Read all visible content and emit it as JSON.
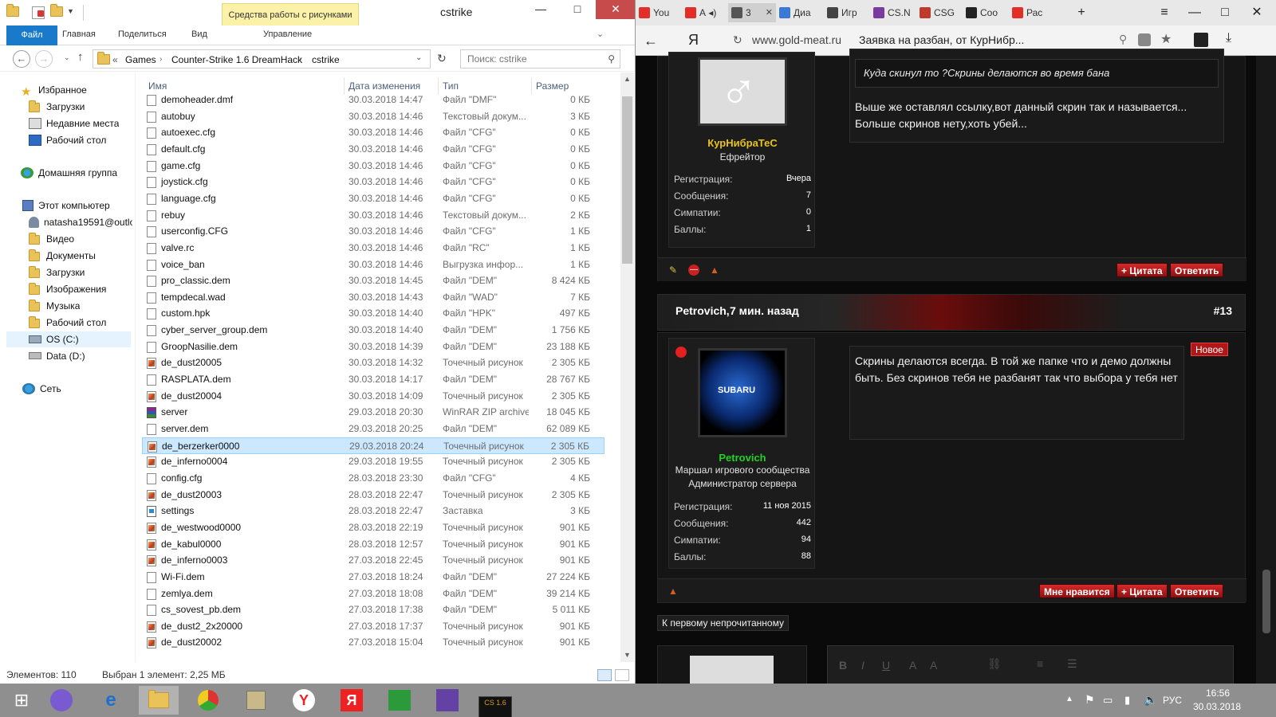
{
  "explorer": {
    "title": "cstrike",
    "context_tab": "Средства работы с рисунками",
    "ribbon_tabs": [
      "Файл",
      "Главная",
      "Поделиться",
      "Вид"
    ],
    "ribbon_context_label": "Управление",
    "breadcrumb": [
      "Games",
      "Counter-Strike 1.6 DreamHack",
      "cstrike"
    ],
    "breadcrumb_prefix": "«",
    "search_placeholder": "Поиск: cstrike",
    "nav": {
      "favorites": "Избранное",
      "fav_items": [
        "Загрузки",
        "Недавние места",
        "Рабочий стол"
      ],
      "homegroup": "Домашняя группа",
      "this_pc": "Этот компьютер",
      "pc_items": [
        "natasha19591@outlo",
        "Видео",
        "Документы",
        "Загрузки",
        "Изображения",
        "Музыка",
        "Рабочий стол",
        "OS (C:)",
        "Data (D:)"
      ],
      "network": "Сеть"
    },
    "columns": {
      "name": "Имя",
      "date": "Дата изменения",
      "type": "Тип",
      "size": "Размер"
    },
    "files": [
      {
        "name": "demoheader.dmf",
        "date": "30.03.2018 14:47",
        "type": "Файл \"DMF\"",
        "size": "0 КБ",
        "icon": "doc"
      },
      {
        "name": "autobuy",
        "date": "30.03.2018 14:46",
        "type": "Текстовый докум...",
        "size": "3 КБ",
        "icon": "doc"
      },
      {
        "name": "autoexec.cfg",
        "date": "30.03.2018 14:46",
        "type": "Файл \"CFG\"",
        "size": "0 КБ",
        "icon": "doc"
      },
      {
        "name": "default.cfg",
        "date": "30.03.2018 14:46",
        "type": "Файл \"CFG\"",
        "size": "0 КБ",
        "icon": "doc"
      },
      {
        "name": "game.cfg",
        "date": "30.03.2018 14:46",
        "type": "Файл \"CFG\"",
        "size": "0 КБ",
        "icon": "doc"
      },
      {
        "name": "joystick.cfg",
        "date": "30.03.2018 14:46",
        "type": "Файл \"CFG\"",
        "size": "0 КБ",
        "icon": "doc"
      },
      {
        "name": "language.cfg",
        "date": "30.03.2018 14:46",
        "type": "Файл \"CFG\"",
        "size": "0 КБ",
        "icon": "doc"
      },
      {
        "name": "rebuy",
        "date": "30.03.2018 14:46",
        "type": "Текстовый докум...",
        "size": "2 КБ",
        "icon": "doc"
      },
      {
        "name": "userconfig.CFG",
        "date": "30.03.2018 14:46",
        "type": "Файл \"CFG\"",
        "size": "1 КБ",
        "icon": "doc"
      },
      {
        "name": "valve.rc",
        "date": "30.03.2018 14:46",
        "type": "Файл \"RC\"",
        "size": "1 КБ",
        "icon": "doc"
      },
      {
        "name": "voice_ban",
        "date": "30.03.2018 14:46",
        "type": "Выгрузка инфор...",
        "size": "1 КБ",
        "icon": "doc"
      },
      {
        "name": "pro_classic.dem",
        "date": "30.03.2018 14:45",
        "type": "Файл \"DEM\"",
        "size": "8 424 КБ",
        "icon": "doc"
      },
      {
        "name": "tempdecal.wad",
        "date": "30.03.2018 14:43",
        "type": "Файл \"WAD\"",
        "size": "7 КБ",
        "icon": "doc"
      },
      {
        "name": "custom.hpk",
        "date": "30.03.2018 14:40",
        "type": "Файл \"HPK\"",
        "size": "497 КБ",
        "icon": "doc"
      },
      {
        "name": "cyber_server_group.dem",
        "date": "30.03.2018 14:40",
        "type": "Файл \"DEM\"",
        "size": "1 756 КБ",
        "icon": "doc"
      },
      {
        "name": "GroopNasilie.dem",
        "date": "30.03.2018 14:39",
        "type": "Файл \"DEM\"",
        "size": "23 188 КБ",
        "icon": "doc"
      },
      {
        "name": "de_dust20005",
        "date": "30.03.2018 14:32",
        "type": "Точечный рисунок",
        "size": "2 305 КБ",
        "icon": "bmp"
      },
      {
        "name": "RASPLATA.dem",
        "date": "30.03.2018 14:17",
        "type": "Файл \"DEM\"",
        "size": "28 767 КБ",
        "icon": "doc"
      },
      {
        "name": "de_dust20004",
        "date": "30.03.2018 14:09",
        "type": "Точечный рисунок",
        "size": "2 305 КБ",
        "icon": "bmp"
      },
      {
        "name": "server",
        "date": "29.03.2018 20:30",
        "type": "WinRAR ZIP archive",
        "size": "18 045 КБ",
        "icon": "rar"
      },
      {
        "name": "server.dem",
        "date": "29.03.2018 20:25",
        "type": "Файл \"DEM\"",
        "size": "62 089 КБ",
        "icon": "doc"
      },
      {
        "name": "de_berzerker0000",
        "date": "29.03.2018 20:24",
        "type": "Точечный рисунок",
        "size": "2 305 КБ",
        "icon": "bmp",
        "selected": true
      },
      {
        "name": "de_inferno0004",
        "date": "29.03.2018 19:55",
        "type": "Точечный рисунок",
        "size": "2 305 КБ",
        "icon": "bmp"
      },
      {
        "name": "config.cfg",
        "date": "28.03.2018 23:30",
        "type": "Файл \"CFG\"",
        "size": "4 КБ",
        "icon": "doc"
      },
      {
        "name": "de_dust20003",
        "date": "28.03.2018 22:47",
        "type": "Точечный рисунок",
        "size": "2 305 КБ",
        "icon": "bmp"
      },
      {
        "name": "settings",
        "date": "28.03.2018 22:47",
        "type": "Заставка",
        "size": "3 КБ",
        "icon": "scr"
      },
      {
        "name": "de_westwood0000",
        "date": "28.03.2018 22:19",
        "type": "Точечный рисунок",
        "size": "901 КБ",
        "icon": "bmp"
      },
      {
        "name": "de_kabul0000",
        "date": "28.03.2018 12:57",
        "type": "Точечный рисунок",
        "size": "901 КБ",
        "icon": "bmp"
      },
      {
        "name": "de_inferno0003",
        "date": "27.03.2018 22:45",
        "type": "Точечный рисунок",
        "size": "901 КБ",
        "icon": "bmp"
      },
      {
        "name": "Wi-Fi.dem",
        "date": "27.03.2018 18:24",
        "type": "Файл \"DEM\"",
        "size": "27 224 КБ",
        "icon": "doc"
      },
      {
        "name": "zemlya.dem",
        "date": "27.03.2018 18:08",
        "type": "Файл \"DEM\"",
        "size": "39 214 КБ",
        "icon": "doc"
      },
      {
        "name": "cs_sovest_pb.dem",
        "date": "27.03.2018 17:38",
        "type": "Файл \"DEM\"",
        "size": "5 011 КБ",
        "icon": "doc"
      },
      {
        "name": "de_dust2_2x20000",
        "date": "27.03.2018 17:37",
        "type": "Точечный рисунок",
        "size": "901 КБ",
        "icon": "bmp"
      },
      {
        "name": "de_dust20002",
        "date": "27.03.2018 15:04",
        "type": "Точечный рисунок",
        "size": "901 КБ",
        "icon": "bmp"
      }
    ],
    "status_count": "Элементов: 110",
    "status_selected": "Выбран 1 элемент: 2,25 МБ"
  },
  "browser": {
    "tabs": [
      {
        "label": "You",
        "color": "#e52d27"
      },
      {
        "label": "А ◂)",
        "color": "#e52d27"
      },
      {
        "label": "3",
        "color": "#555555",
        "active": true
      },
      {
        "label": "Диа",
        "color": "#3a7ad5"
      },
      {
        "label": "Игр",
        "color": "#444444"
      },
      {
        "label": "CS.N",
        "color": "#7a3aa0"
      },
      {
        "label": "CSG",
        "color": "#c0392b"
      },
      {
        "label": "Coo",
        "color": "#222222"
      },
      {
        "label": "Рас",
        "color": "#e52d27"
      }
    ],
    "url": "www.gold-meat.ru",
    "page_title": "Заявка на разбан, от КурНибр...",
    "post1": {
      "quote": "Куда скинул то ?Скрины делаются во время бана",
      "message": "Выше же оставлял ссылку,вот данный скрин так и называется... Больше скринов нету,хоть убей...",
      "author": "КурНибраТеС",
      "rank": "Ефрейтор",
      "stats": [
        {
          "k": "Регистрация:",
          "v": "Вчера"
        },
        {
          "k": "Сообщения:",
          "v": "7"
        },
        {
          "k": "Симпатии:",
          "v": "0"
        },
        {
          "k": "Баллы:",
          "v": "1"
        }
      ],
      "buttons": [
        "+ Цитата",
        "Ответить"
      ]
    },
    "post2": {
      "author": "Petrovich,",
      "time": "7 мин. назад",
      "number": "#13",
      "badge": "Новое",
      "message": "Скрины делаются всегда. В той же папке что и демо должны быть. Без скринов тебя не разбанят так что выбора у тебя нет",
      "name": "Petrovich",
      "avatar_label": "SUBARU",
      "rank1": "Маршал игрового сообщества",
      "rank2": "Администратор сервера",
      "stats": [
        {
          "k": "Регистрация:",
          "v": "11 ноя 2015"
        },
        {
          "k": "Сообщения:",
          "v": "442"
        },
        {
          "k": "Симпатии:",
          "v": "94"
        },
        {
          "k": "Баллы:",
          "v": "88"
        }
      ],
      "buttons": [
        "Мне нравится",
        "+ Цитата",
        "Ответить"
      ]
    },
    "first_unread": "К первому непрочитанному"
  },
  "taskbar": {
    "lang": "РУС",
    "time": "16:56",
    "date": "30.03.2018",
    "csgo_label": "CS 1.6"
  },
  "colors": {
    "accent_blue": "#1979ca",
    "forum_red": "#d62a2a",
    "name_gold": "#e8c31c",
    "name_green": "#23d223"
  }
}
